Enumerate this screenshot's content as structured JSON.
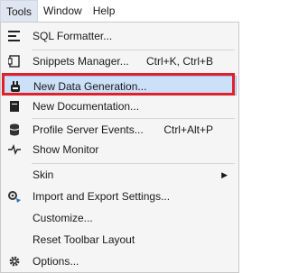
{
  "menubar": {
    "items": [
      "Tools",
      "Window",
      "Help"
    ]
  },
  "menu": {
    "sql_formatter": "SQL Formatter...",
    "snippets_manager": "Snippets Manager...",
    "snippets_shortcut": "Ctrl+K, Ctrl+B",
    "new_data_generation": "New Data Generation...",
    "new_documentation": "New Documentation...",
    "profile_server_events": "Profile Server Events...",
    "profile_shortcut": "Ctrl+Alt+P",
    "show_monitor": "Show Monitor",
    "skin": "Skin",
    "import_export": "Import and Export Settings...",
    "customize": "Customize...",
    "reset_toolbar": "Reset Toolbar Layout",
    "options": "Options..."
  },
  "colors": {
    "highlight_outline": "#e0202a",
    "hover_bg": "#cce0f7"
  }
}
